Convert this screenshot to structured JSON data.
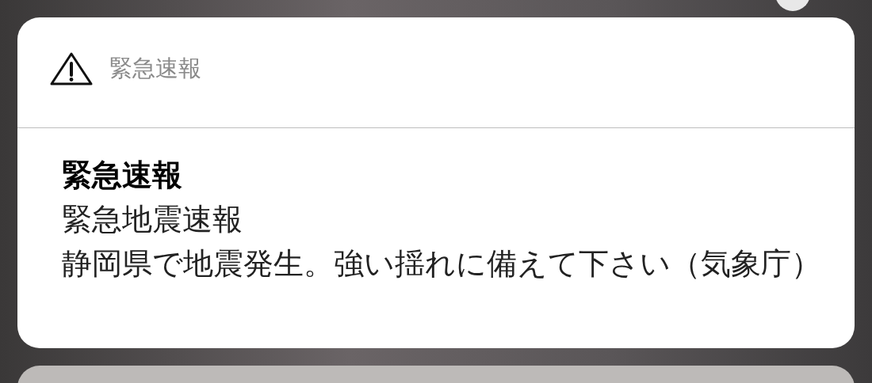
{
  "notification": {
    "app_name": "緊急速報",
    "title": "緊急速報",
    "lines": [
      "緊急地震速報",
      "静岡県で地震発生。強い揺れに備えて下さい（気象庁）"
    ]
  }
}
